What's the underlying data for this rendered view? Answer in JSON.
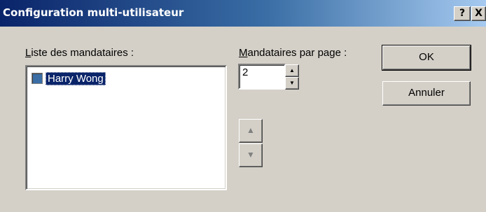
{
  "window": {
    "title": "Configuration multi-utilisateur",
    "help_label": "?",
    "close_label": "X"
  },
  "proxy_list": {
    "label_hotkey": "L",
    "label_rest": "iste des mandataires :",
    "items": [
      {
        "label": "Harry Wong",
        "checked": false,
        "selected": true
      }
    ]
  },
  "per_page": {
    "label_hotkey": "M",
    "label_rest": "andataires par page :",
    "value": "2",
    "up_icon": "▲",
    "down_icon": "▼"
  },
  "move_buttons": {
    "up_icon": "▲",
    "down_icon": "▼"
  },
  "buttons": {
    "ok": "OK",
    "cancel": "Annuler"
  }
}
